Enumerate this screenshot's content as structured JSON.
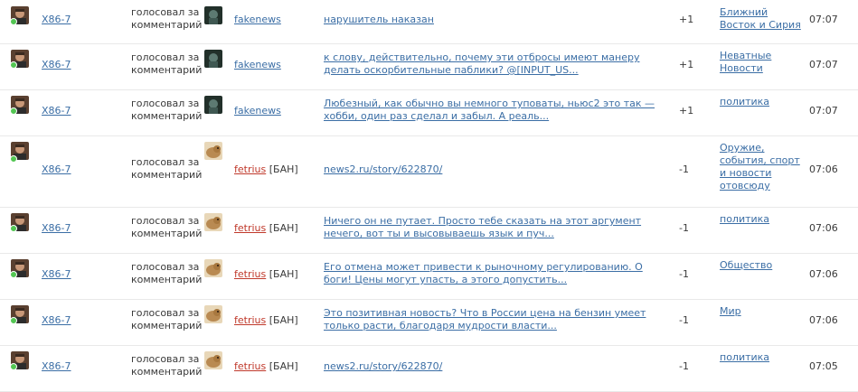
{
  "action_text": "голосовал за комментарий",
  "ban_text": "[БАН]",
  "rows": [
    {
      "user": "X86-7",
      "target": "fakenews",
      "banned": false,
      "comment": "нарушитель наказан",
      "vote": "+1",
      "tag": "Ближний Восток и Сирия",
      "time": "07:07"
    },
    {
      "user": "X86-7",
      "target": "fakenews",
      "banned": false,
      "comment": "к слову, действительно, почему эти отбросы имеют манеру делать оскорбительные паблики? @[INPUT_US...",
      "vote": "+1",
      "tag": "Неватные Новости",
      "time": "07:07"
    },
    {
      "user": "X86-7",
      "target": "fakenews",
      "banned": false,
      "comment": "Любезный, как обычно вы немного туповаты, ньюс2 это так — хобби, один раз сделал и забыл. А реаль...",
      "vote": "+1",
      "tag": "политика",
      "time": "07:07"
    },
    {
      "user": "X86-7",
      "target": "fetrius",
      "banned": true,
      "comment": "news2.ru/story/622870/",
      "vote": "-1",
      "tag": "Оружие, события, спорт и новости отовсюду",
      "time": "07:06"
    },
    {
      "user": "X86-7",
      "target": "fetrius",
      "banned": true,
      "comment": "Ничего он не путает. Просто тебе сказать на этот аргумент нечего, вот ты и высовываешь язык и пуч...",
      "vote": "-1",
      "tag": "политика",
      "time": "07:06"
    },
    {
      "user": "X86-7",
      "target": "fetrius",
      "banned": true,
      "comment": "Его отмена может привести к рыночному регулированию. О боги! Цены могут упасть, а этого допустить...",
      "vote": "-1",
      "tag": "Общество",
      "time": "07:06"
    },
    {
      "user": "X86-7",
      "target": "fetrius",
      "banned": true,
      "comment": "Это позитивная новость? Что в России цена на бензин умеет только расти, благодаря мудрости власти...",
      "vote": "-1",
      "tag": "Мир",
      "time": "07:06"
    },
    {
      "user": "X86-7",
      "target": "fetrius",
      "banned": true,
      "comment": "news2.ru/story/622870/",
      "vote": "-1",
      "tag": "политика",
      "time": "07:05"
    }
  ]
}
